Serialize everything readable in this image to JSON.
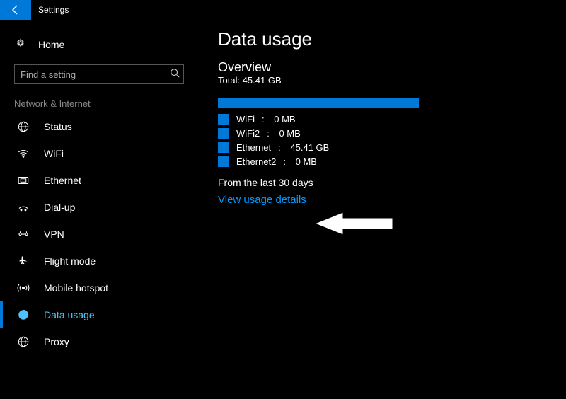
{
  "header": {
    "app_title": "Settings"
  },
  "sidebar": {
    "home_label": "Home",
    "search_placeholder": "Find a setting",
    "category_label": "Network & Internet",
    "items": [
      {
        "label": "Status",
        "icon": "status"
      },
      {
        "label": "WiFi",
        "icon": "wifi"
      },
      {
        "label": "Ethernet",
        "icon": "ethernet"
      },
      {
        "label": "Dial-up",
        "icon": "dialup"
      },
      {
        "label": "VPN",
        "icon": "vpn"
      },
      {
        "label": "Flight mode",
        "icon": "flight"
      },
      {
        "label": "Mobile hotspot",
        "icon": "hotspot"
      },
      {
        "label": "Data usage",
        "icon": "data",
        "active": true
      },
      {
        "label": "Proxy",
        "icon": "proxy"
      }
    ]
  },
  "main": {
    "title": "Data usage",
    "overview_label": "Overview",
    "total_label": "Total: 45.41 GB",
    "usage": [
      {
        "name": "WiFi",
        "value": "0 MB"
      },
      {
        "name": "WiFi2",
        "value": "0 MB"
      },
      {
        "name": "Ethernet",
        "value": "45.41 GB"
      },
      {
        "name": "Ethernet2",
        "value": "0 MB"
      }
    ],
    "period_label": "From the last 30 days",
    "details_link": "View usage details"
  },
  "colors": {
    "accent": "#0078d7",
    "link": "#0099ff"
  }
}
